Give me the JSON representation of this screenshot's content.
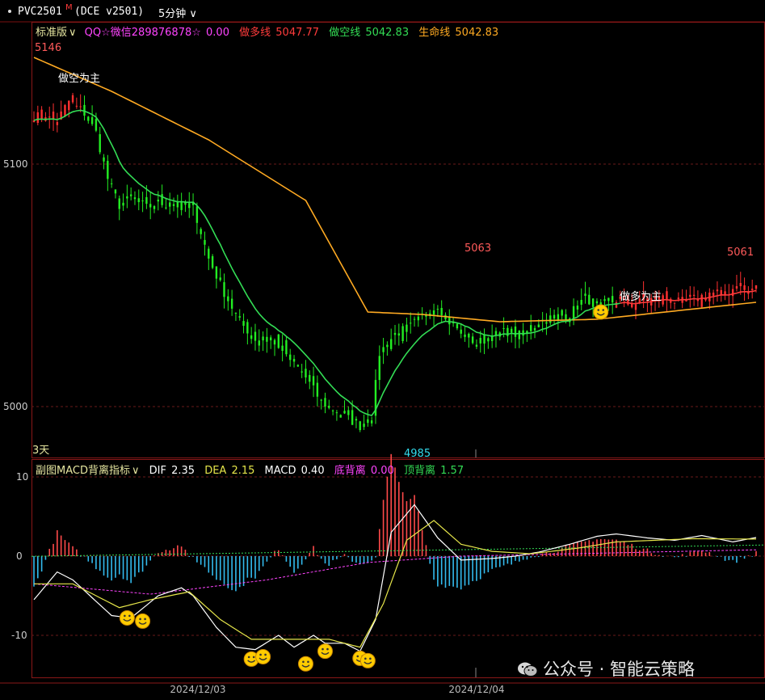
{
  "header": {
    "symbol": "PVC2501",
    "symbol_sup": "M",
    "exchange": "(DCE v2501)",
    "period": "5分钟",
    "period_arrow": "∨"
  },
  "main_panel": {
    "version_label": "标准版",
    "qq_label": "QQ☆微信289876878☆",
    "qq_value": "0.00",
    "long_label": "做多线",
    "long_value": "5047.77",
    "short_label": "做空线",
    "short_value": "5042.83",
    "life_label": "生命线",
    "life_value": "5042.83",
    "colors": {
      "long": "#ff3b3b",
      "short": "#33dd55",
      "life": "#ffaa22",
      "qq": "#ff44ff",
      "label": "#e6e6a0"
    },
    "y_ticks": [
      {
        "v": 5100,
        "label": "5100"
      },
      {
        "v": 5000,
        "label": "5000"
      }
    ],
    "annotations": [
      {
        "text": "5146",
        "kind": "high"
      },
      {
        "text": "5063",
        "kind": "high"
      },
      {
        "text": "5061",
        "kind": "high"
      },
      {
        "text": "4985",
        "kind": "low"
      },
      {
        "text": "做空为主",
        "kind": "signal"
      },
      {
        "text": "做多为主",
        "kind": "signal"
      },
      {
        "text": "3天",
        "kind": "days"
      }
    ]
  },
  "sub_panel": {
    "title": "副图MACD背离指标",
    "title_arrow": "∨",
    "dif_label": "DIF",
    "dif_value": "2.35",
    "dea_label": "DEA",
    "dea_value": "2.15",
    "macd_label": "MACD",
    "macd_value": "0.40",
    "bottom_div_label": "底背离",
    "bottom_div_value": "0.00",
    "top_div_label": "顶背离",
    "top_div_value": "1.57",
    "y_ticks": [
      {
        "v": 10,
        "label": "10"
      },
      {
        "v": 0,
        "label": "0"
      },
      {
        "v": -10,
        "label": "-10"
      }
    ]
  },
  "x_axis": {
    "dates": [
      "2024/12/03",
      "2024/12/04"
    ]
  },
  "watermark": "公众号 · 智能云策略",
  "chart_data": {
    "type": "candlestick",
    "main": {
      "ylim": [
        4985,
        5146
      ],
      "close_anchors": [
        [
          0,
          5120
        ],
        [
          6,
          5118
        ],
        [
          9,
          5126
        ],
        [
          13,
          5121
        ],
        [
          16,
          5113
        ],
        [
          19,
          5094
        ],
        [
          22,
          5083
        ],
        [
          25,
          5086
        ],
        [
          29,
          5082
        ],
        [
          32,
          5084
        ],
        [
          36,
          5083
        ],
        [
          41,
          5083
        ],
        [
          45,
          5061
        ],
        [
          49,
          5047
        ],
        [
          53,
          5035
        ],
        [
          57,
          5028
        ],
        [
          62,
          5027
        ],
        [
          66,
          5020
        ],
        [
          70,
          5012
        ],
        [
          74,
          5002
        ],
        [
          78,
          4998
        ],
        [
          82,
          4994
        ],
        [
          84,
          4992
        ],
        [
          87,
          4996
        ],
        [
          89,
          5022
        ],
        [
          93,
          5030
        ],
        [
          97,
          5033
        ],
        [
          101,
          5038
        ],
        [
          104,
          5042
        ],
        [
          107,
          5035
        ],
        [
          110,
          5031
        ],
        [
          114,
          5026
        ],
        [
          118,
          5029
        ],
        [
          122,
          5031
        ],
        [
          126,
          5029
        ],
        [
          130,
          5035
        ],
        [
          134,
          5037
        ],
        [
          138,
          5038
        ],
        [
          142,
          5045
        ],
        [
          146,
          5041
        ],
        [
          150,
          5044
        ],
        [
          154,
          5042
        ],
        [
          158,
          5044
        ],
        [
          162,
          5045
        ],
        [
          166,
          5043
        ],
        [
          170,
          5044
        ],
        [
          174,
          5047
        ],
        [
          178,
          5046
        ],
        [
          181,
          5050
        ],
        [
          184,
          5047
        ],
        [
          186,
          5049
        ]
      ],
      "n_bars": 187,
      "life_anchors": [
        [
          0,
          5144
        ],
        [
          20,
          5130
        ],
        [
          45,
          5110
        ],
        [
          70,
          5085
        ],
        [
          86,
          5039
        ],
        [
          100,
          5038
        ],
        [
          120,
          5035
        ],
        [
          145,
          5036
        ],
        [
          186,
          5043
        ]
      ],
      "signals": [
        {
          "text": "做空为主",
          "bar": 9,
          "price": 5124
        },
        {
          "text": "做多为主",
          "bar": 150,
          "price": 5037
        }
      ]
    },
    "macd": {
      "ylim": [
        -15,
        10
      ],
      "dif_anchors": [
        [
          0,
          -5.5
        ],
        [
          6,
          -2
        ],
        [
          10,
          -3
        ],
        [
          20,
          -7.5
        ],
        [
          25,
          -7.8
        ],
        [
          32,
          -5
        ],
        [
          38,
          -4
        ],
        [
          41,
          -5
        ],
        [
          47,
          -9
        ],
        [
          52,
          -11.5
        ],
        [
          57,
          -11.8
        ],
        [
          63,
          -10
        ],
        [
          67,
          -11.5
        ],
        [
          72,
          -10
        ],
        [
          75,
          -11
        ],
        [
          80,
          -11
        ],
        [
          84,
          -12
        ],
        [
          88,
          -8
        ],
        [
          92,
          3
        ],
        [
          98,
          6.5
        ],
        [
          104,
          2.3
        ],
        [
          110,
          -0.5
        ],
        [
          118,
          -0.3
        ],
        [
          124,
          0
        ],
        [
          130,
          0.5
        ],
        [
          138,
          1.5
        ],
        [
          145,
          2.5
        ],
        [
          150,
          2.8
        ],
        [
          158,
          2.3
        ],
        [
          165,
          2
        ],
        [
          172,
          2.6
        ],
        [
          180,
          1.8
        ],
        [
          186,
          2.35
        ]
      ],
      "dea_anchors": [
        [
          0,
          -3.5
        ],
        [
          10,
          -3.5
        ],
        [
          22,
          -6.5
        ],
        [
          30,
          -5.5
        ],
        [
          40,
          -4.5
        ],
        [
          48,
          -8
        ],
        [
          56,
          -10.5
        ],
        [
          66,
          -10.5
        ],
        [
          76,
          -10.5
        ],
        [
          84,
          -11.5
        ],
        [
          90,
          -6
        ],
        [
          96,
          2
        ],
        [
          103,
          4.5
        ],
        [
          110,
          1.5
        ],
        [
          118,
          0.6
        ],
        [
          128,
          0.3
        ],
        [
          140,
          1
        ],
        [
          150,
          1.8
        ],
        [
          160,
          2
        ],
        [
          170,
          2.2
        ],
        [
          186,
          2.15
        ]
      ],
      "zero_dashed_level": 1.2,
      "magenta_anchors": [
        [
          0,
          -3.5
        ],
        [
          30,
          -4.8
        ],
        [
          60,
          -3
        ],
        [
          86,
          -0.8
        ],
        [
          110,
          0
        ],
        [
          186,
          0.8
        ]
      ],
      "smileys": [
        [
          24,
          -7.8
        ],
        [
          28,
          -8.2
        ],
        [
          56,
          -13
        ],
        [
          59,
          -12.7
        ],
        [
          70,
          -13.6
        ],
        [
          75,
          -12
        ],
        [
          84,
          -12.9
        ],
        [
          86,
          -13.2
        ]
      ]
    }
  }
}
